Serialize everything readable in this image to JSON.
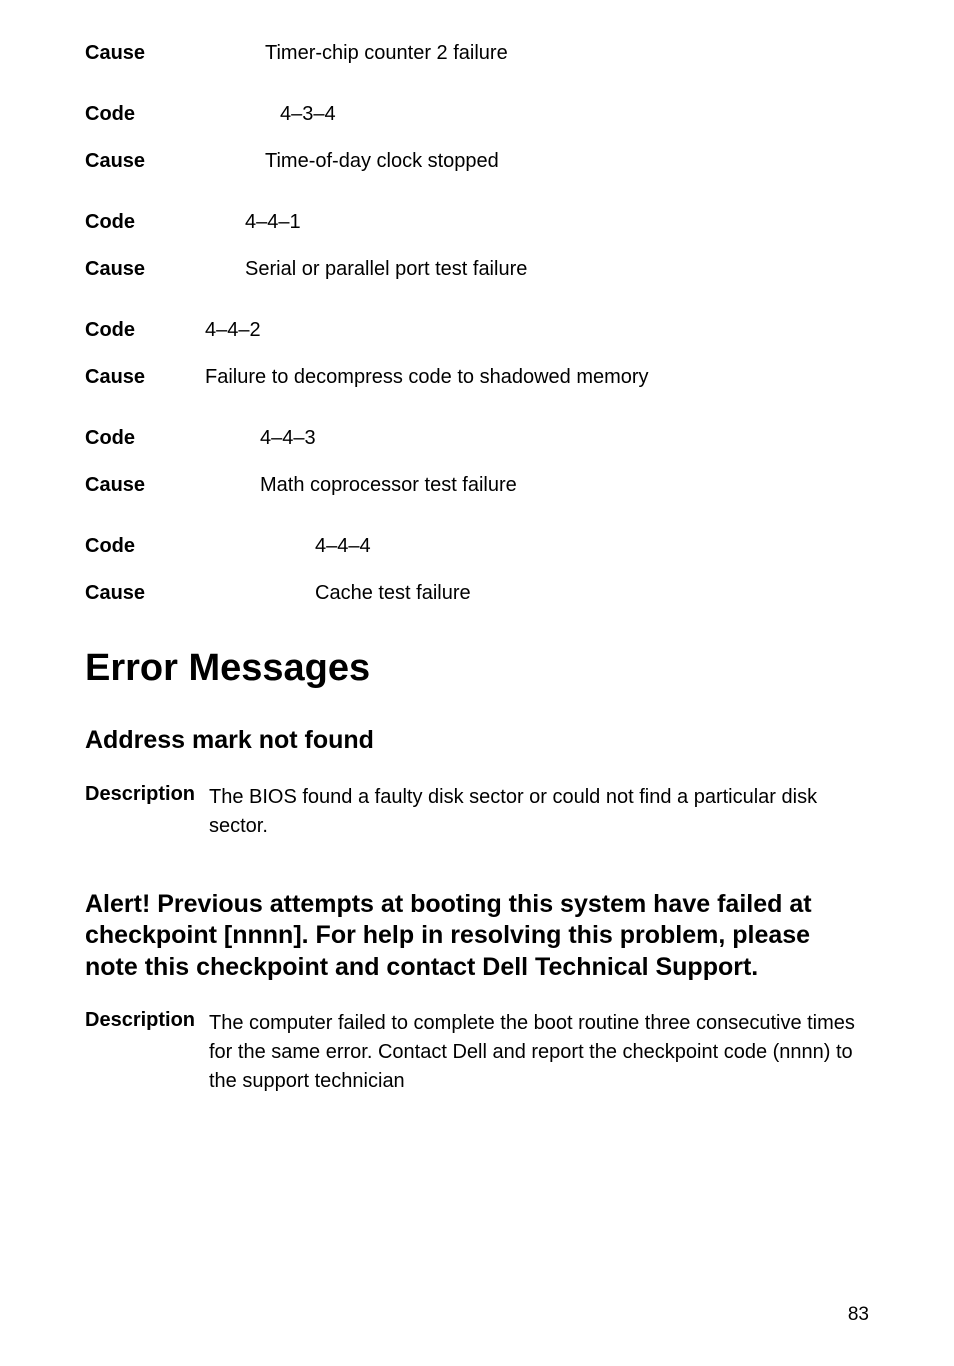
{
  "codes": [
    {
      "label": "Cause",
      "value": "Timer-chip counter 2 failure",
      "labelWidth": "180px",
      "gap": true
    },
    {
      "label": "Code",
      "value": "4–3–4",
      "labelWidth": "195px"
    },
    {
      "label": "Cause",
      "value": "Time-of-day clock stopped",
      "labelWidth": "180px",
      "gap": true
    },
    {
      "label": "Code",
      "value": "4–4–1",
      "labelWidth": "160px"
    },
    {
      "label": "Cause",
      "value": "Serial or parallel port test failure",
      "labelWidth": "160px",
      "gap": true
    },
    {
      "label": "Code",
      "value": "4–4–2",
      "labelWidth": "120px"
    },
    {
      "label": "Cause",
      "value": "Failure to decompress code to shadowed memory",
      "labelWidth": "120px",
      "gap": true
    },
    {
      "label": "Code",
      "value": "4–4–3",
      "labelWidth": "175px"
    },
    {
      "label": "Cause",
      "value": "Math coprocessor test failure",
      "labelWidth": "175px",
      "gap": true
    },
    {
      "label": "Code",
      "value": "4–4–4",
      "labelWidth": "230px"
    },
    {
      "label": "Cause",
      "value": "Cache test failure",
      "labelWidth": "230px"
    }
  ],
  "h1": "Error Messages",
  "section1": {
    "heading": "Address mark not found",
    "descLabel": "Description",
    "descText": "The BIOS found a faulty disk sector or could not find a particular disk sector."
  },
  "section2": {
    "heading": "Alert! Previous attempts at booting this system have failed at checkpoint [nnnn]. For help in resolving this problem, please note this checkpoint and contact Dell Technical Support.",
    "descLabel": "Description",
    "descText": "The computer failed to complete the boot routine three consecutive times for the same error. Contact Dell and report the checkpoint code (nnnn) to the support technician"
  },
  "pageNumber": "83"
}
